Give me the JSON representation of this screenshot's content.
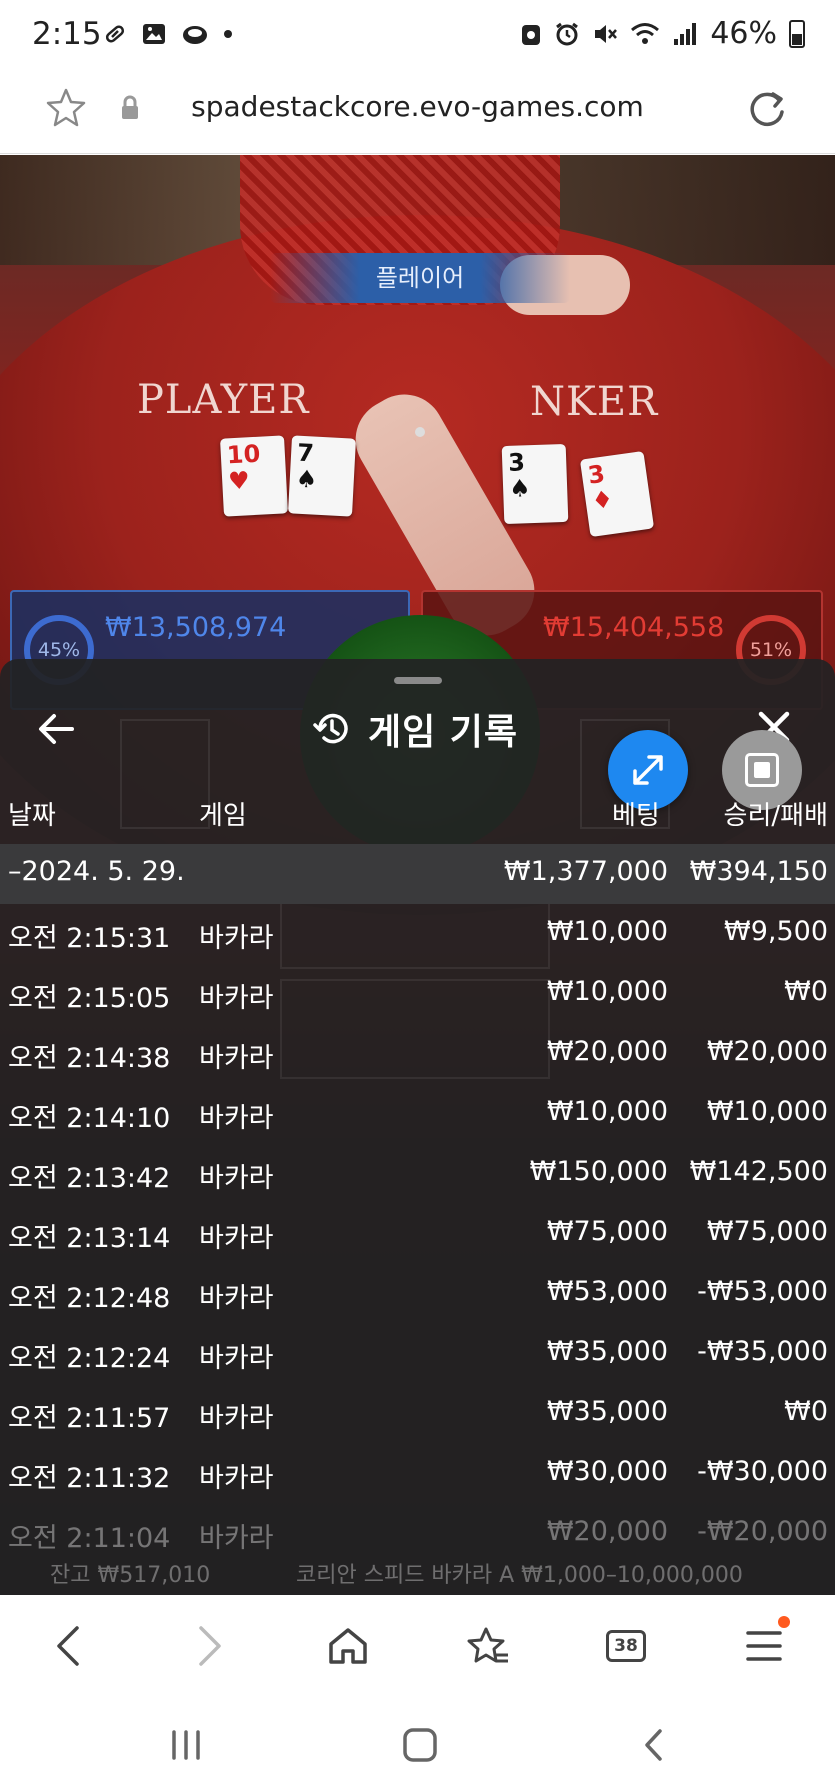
{
  "status_bar": {
    "time": "2:15",
    "battery": "46%"
  },
  "url_bar": {
    "url": "spadestackcore.evo-games.com"
  },
  "game_table": {
    "player_pill": "플레이어",
    "player_label": "PLAYER",
    "banker_label": "NKER",
    "player_cards": [
      "10",
      "7"
    ],
    "banker_cards": [
      "3",
      "3"
    ],
    "player_pct": "45%",
    "banker_pct": "51%",
    "player_amount": "₩13,508,974",
    "banker_amount": "₩15,404,558"
  },
  "history": {
    "title": "게임 기록",
    "headers": {
      "date": "날짜",
      "game": "게임",
      "bet": "베팅",
      "result": "승리/패배"
    },
    "date_group": {
      "date": "–2024. 5. 29.",
      "total_bet": "₩1,377,000",
      "total_result": "₩394,150"
    },
    "rows": [
      {
        "time": "오전 2:15:31",
        "game": "바카라",
        "bet": "₩10,000",
        "result": "₩9,500"
      },
      {
        "time": "오전 2:15:05",
        "game": "바카라",
        "bet": "₩10,000",
        "result": "₩0"
      },
      {
        "time": "오전 2:14:38",
        "game": "바카라",
        "bet": "₩20,000",
        "result": "₩20,000"
      },
      {
        "time": "오전 2:14:10",
        "game": "바카라",
        "bet": "₩10,000",
        "result": "₩10,000"
      },
      {
        "time": "오전 2:13:42",
        "game": "바카라",
        "bet": "₩150,000",
        "result": "₩142,500"
      },
      {
        "time": "오전 2:13:14",
        "game": "바카라",
        "bet": "₩75,000",
        "result": "₩75,000"
      },
      {
        "time": "오전 2:12:48",
        "game": "바카라",
        "bet": "₩53,000",
        "result": "-₩53,000"
      },
      {
        "time": "오전 2:12:24",
        "game": "바카라",
        "bet": "₩35,000",
        "result": "-₩35,000"
      },
      {
        "time": "오전 2:11:57",
        "game": "바카라",
        "bet": "₩35,000",
        "result": "₩0"
      },
      {
        "time": "오전 2:11:32",
        "game": "바카라",
        "bet": "₩30,000",
        "result": "-₩30,000"
      },
      {
        "time": "오전 2:11:04",
        "game": "바카라",
        "bet": "₩20,000",
        "result": "-₩20,000"
      }
    ],
    "bottom_balance": "잔고 ₩517,010",
    "bottom_table_name": "코리안 스피드 바카라 A ₩1,000–10,000,000"
  },
  "browser_nav": {
    "tab_count": "38"
  },
  "colors": {
    "fab_blue": "#1e88f0",
    "notification_dot": "#ff5a1f",
    "sheet_bg": "#222224"
  }
}
